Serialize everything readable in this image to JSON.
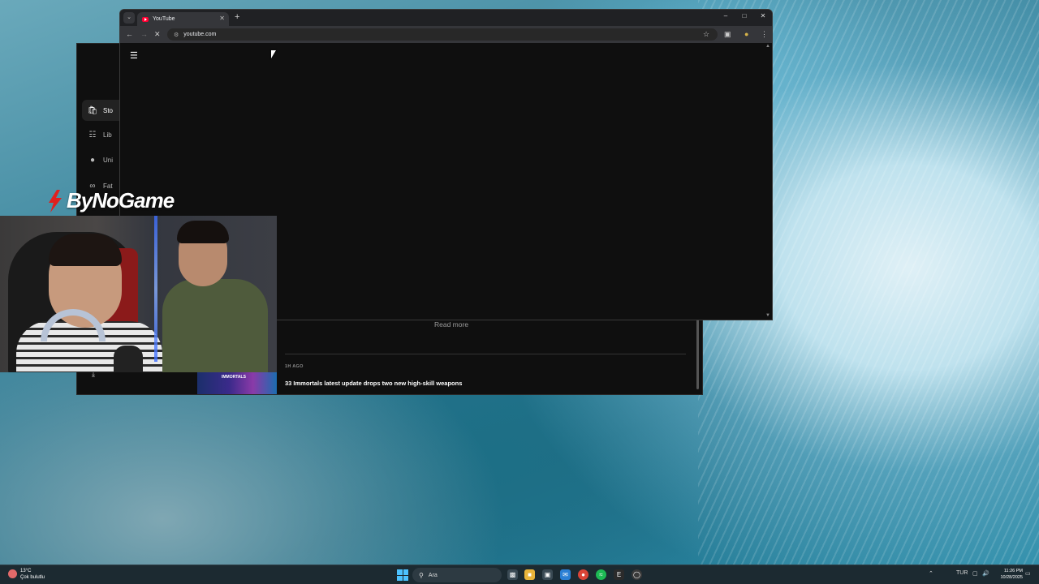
{
  "browser": {
    "tab_title": "YouTube",
    "url": "youtube.com",
    "icons": {
      "tab_search": "chevron-down-icon",
      "tab_close": "close-icon",
      "new_tab": "plus-icon",
      "minimize": "minimize-icon",
      "maximize": "maximize-icon",
      "close": "close-icon",
      "back": "arrow-left-icon",
      "forward": "arrow-right-icon",
      "reload": "stop-loading-icon",
      "site_info": "tune-icon",
      "bookmark": "star-icon",
      "extensions": "puzzle-icon",
      "menu": "more-vert-icon",
      "youtube_menu": "hamburger-icon"
    },
    "brand_color": "#ff0033"
  },
  "news_app": {
    "sidebar": [
      "Sto",
      "Lib",
      "Uni",
      "Fat"
    ],
    "read_more": "Read more",
    "article": {
      "time": "1H AGO",
      "title": "33 Immortals latest update drops two new high-skill weapons",
      "thumb_text": "IMMORTALS"
    }
  },
  "overlay": {
    "logo_text": "ByNoGame",
    "logo_color": "#e0201e"
  },
  "taskbar": {
    "weather_temp": "13°C",
    "weather_desc": "Çok bulutlu",
    "search_placeholder": "Ara",
    "language": "TUR",
    "time": "11:26 PM",
    "date": "10/28/2025",
    "accent": "#4cc2ff"
  }
}
